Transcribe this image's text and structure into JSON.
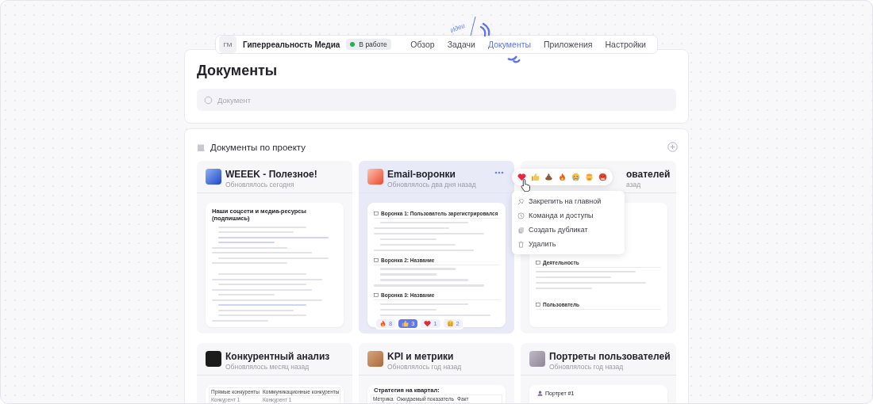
{
  "nav": {
    "avatar": "ГМ",
    "project": "Гиперреальность Медиа",
    "status": "В работе",
    "tabs": [
      {
        "label": "Обзор",
        "selected": false
      },
      {
        "label": "Задачи",
        "selected": false
      },
      {
        "label": "Документы",
        "selected": true
      },
      {
        "label": "Приложения",
        "selected": false
      },
      {
        "label": "Настройки",
        "selected": false
      }
    ]
  },
  "doodle": {
    "label": "Идеи"
  },
  "header": {
    "title": "Документы",
    "search": {
      "placeholder": "Документ"
    }
  },
  "section": {
    "title": "Документы по проекту",
    "cards": [
      {
        "title": "WEEEK - Полезное!",
        "updated": "Обновлялось сегодня",
        "active": false,
        "partial": false,
        "preview": [
          {
            "kind": "heading",
            "text": "Наши соцсети и медиа-ресурсы (подпишись)"
          },
          {
            "kind": "bulletline"
          },
          {
            "kind": "bulletline"
          },
          {
            "kind": "linkline"
          },
          {
            "kind": "linkline"
          },
          {
            "kind": "line"
          },
          {
            "kind": "line"
          },
          {
            "kind": "bulletline"
          },
          {
            "kind": "line"
          },
          {
            "kind": "gap"
          },
          {
            "kind": "bulletline"
          },
          {
            "kind": "line"
          },
          {
            "kind": "bulletline"
          },
          {
            "kind": "line"
          },
          {
            "kind": "bulletline"
          },
          {
            "kind": "line"
          },
          {
            "kind": "linkline"
          },
          {
            "kind": "bulletline"
          },
          {
            "kind": "bulletline"
          },
          {
            "kind": "line"
          }
        ]
      },
      {
        "title": "Email-воронки",
        "updated": "Обновлялось два дня назад",
        "active": true,
        "partial": false,
        "preview": [
          {
            "kind": "subheading",
            "text": "Воронка 1: Пользователь зарегистрировался"
          },
          {
            "kind": "bulletline"
          },
          {
            "kind": "line"
          },
          {
            "kind": "line"
          },
          {
            "kind": "bulletline"
          },
          {
            "kind": "bulletline"
          },
          {
            "kind": "line"
          },
          {
            "kind": "subheading",
            "text": "Воронка 2: Название"
          },
          {
            "kind": "bulletline"
          },
          {
            "kind": "bulletline"
          },
          {
            "kind": "bulletline"
          },
          {
            "kind": "line"
          },
          {
            "kind": "subheading",
            "text": "Воронка 3: Название"
          },
          {
            "kind": "bulletline"
          },
          {
            "kind": "bulletline"
          },
          {
            "kind": "bulletline"
          }
        ],
        "reactions": [
          {
            "kind": "fire",
            "count": "8",
            "selected": false
          },
          {
            "kind": "thumbs",
            "count": "3",
            "selected": true
          },
          {
            "kind": "heart",
            "count": "1",
            "selected": false
          },
          {
            "kind": "cry",
            "count": "2",
            "selected": false
          }
        ],
        "menu": [
          {
            "kind": "pin",
            "label": "Закрепить на главной"
          },
          {
            "kind": "team",
            "label": "Команда и доступы"
          },
          {
            "kind": "copy",
            "label": "Создать дубликат"
          },
          {
            "kind": "trash",
            "label": "Удалить"
          }
        ]
      },
      {
        "title": "ователей",
        "updated": "азад",
        "active": false,
        "partial": true,
        "preview": [
          {
            "kind": "subheading",
            "text": "Деятельность"
          },
          {
            "kind": "line"
          },
          {
            "kind": "line"
          },
          {
            "kind": "line"
          },
          {
            "kind": "line"
          },
          {
            "kind": "gap"
          },
          {
            "kind": "subheading",
            "text": "Пользователь"
          }
        ]
      },
      {
        "title": "Конкурентный анализ",
        "updated": "Обновлялось месяц назад",
        "active": false,
        "partial": false,
        "preview": [
          {
            "kind": "table",
            "columns": [
              "Прямые конкуренты",
              "Коммуникационные конкуренты"
            ],
            "rows": [
              [
                "Конкурент 1",
                "Конкурент 1"
              ]
            ]
          }
        ]
      },
      {
        "title": "KPI и метрики",
        "updated": "Обновлялось год назад",
        "active": false,
        "partial": false,
        "preview": [
          {
            "kind": "heading",
            "text": "Стратегия на квартал:"
          },
          {
            "kind": "table",
            "columns": [
              "Метрика",
              "Ожидаемый показатель",
              "Факт"
            ]
          }
        ]
      },
      {
        "title": "Портреты пользователей",
        "updated": "Обновлялось год назад",
        "active": false,
        "partial": false,
        "preview": [
          {
            "kind": "portrait",
            "text": "Портрет #1"
          }
        ]
      }
    ]
  }
}
